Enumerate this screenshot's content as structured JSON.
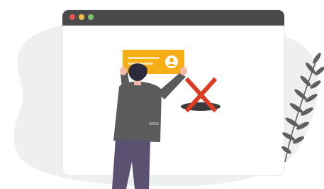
{
  "illustration": {
    "colors": {
      "blob": "#eef0f0",
      "browser_bar": "#4a4a4a",
      "window_body": "#ffffff",
      "dot_red": "#e8554e",
      "dot_yellow": "#f2c04a",
      "dot_green": "#7cc468",
      "card": "#f7ad14",
      "card_lines": "#fde3a6",
      "avatar_circle": "#ffffff",
      "x_mark": "#dc3d24",
      "shadow": "#3b3b3b",
      "jacket": "#5b5b5b",
      "jacket_light": "#8b8b8b",
      "pants": "#5b5170",
      "hair": "#2b2b3b",
      "skin": "#f2b9a8",
      "plant": "#5f5f5f"
    },
    "icons": [
      "browser-window",
      "profile-card-icon",
      "x-mark-icon",
      "person-figure",
      "fern-plant"
    ]
  }
}
